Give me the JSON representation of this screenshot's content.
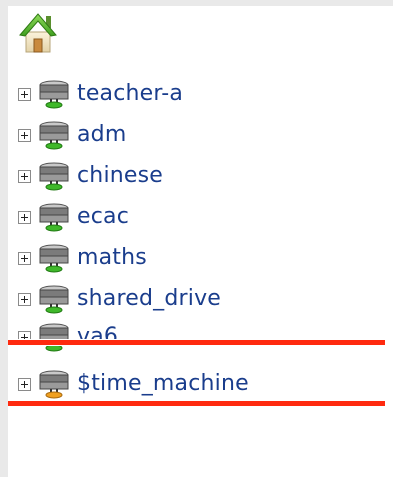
{
  "tree": {
    "root_icon": "home-icon",
    "items": [
      {
        "label": "teacher-a",
        "icon": "network-drive-icon"
      },
      {
        "label": "adm",
        "icon": "network-drive-icon"
      },
      {
        "label": "chinese",
        "icon": "network-drive-icon"
      },
      {
        "label": "ecac",
        "icon": "network-drive-icon"
      },
      {
        "label": "maths",
        "icon": "network-drive-icon"
      },
      {
        "label": "shared_drive",
        "icon": "network-drive-icon"
      },
      {
        "label": "va6",
        "icon": "network-drive-icon"
      },
      {
        "label": "$time_machine",
        "icon": "network-drive-icon-orange"
      }
    ]
  },
  "colors": {
    "label": "#1a3d8c",
    "highlight": "#ff2a0f",
    "background": "#e9e9e9",
    "panel": "#ffffff"
  }
}
